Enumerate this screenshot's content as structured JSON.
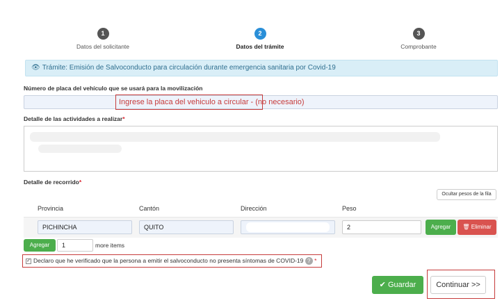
{
  "steps": [
    {
      "number": "1",
      "label": "Datos del solicitante"
    },
    {
      "number": "2",
      "label": "Datos del trámite"
    },
    {
      "number": "3",
      "label": "Comprobante"
    }
  ],
  "banner": {
    "text": "Trámite: Emisión de Salvoconducto para circulación durante emergencia sanitaria por Covid-19"
  },
  "plate": {
    "label": "Número de placa del vehículo que se usará para la movilización",
    "value": "",
    "annotation": "Ingrese la placa del vehiculo a circular - (no necesario)"
  },
  "activities": {
    "label": "Detalle de las actividades a realizar",
    "required": "*"
  },
  "route": {
    "label": "Detalle de recorrido",
    "required": "*",
    "toggle_button": "Ocultar pesos de la fila",
    "columns": [
      "Provincia",
      "Cantón",
      "Dirección",
      "Peso"
    ],
    "row": {
      "provincia": "PICHINCHA",
      "canton": "QUITO",
      "direccion": "",
      "peso": "2"
    },
    "add_row_button": "Agregar",
    "delete_row_button": "Eliminar"
  },
  "add_more": {
    "button": "Agregar",
    "count": "1",
    "suffix": "more items"
  },
  "declaration": {
    "text": "Declaro que he verificado que la persona a emitir el salvoconducto no presenta síntomas de COVID-19",
    "required": "*",
    "checked": true
  },
  "actions": {
    "save": "Guardar",
    "continue": "Continuar >>"
  },
  "colors": {
    "accent": "#2a8fd8",
    "green": "#4cae4c",
    "red": "#d9534f",
    "annotation": "#c63b3b"
  }
}
